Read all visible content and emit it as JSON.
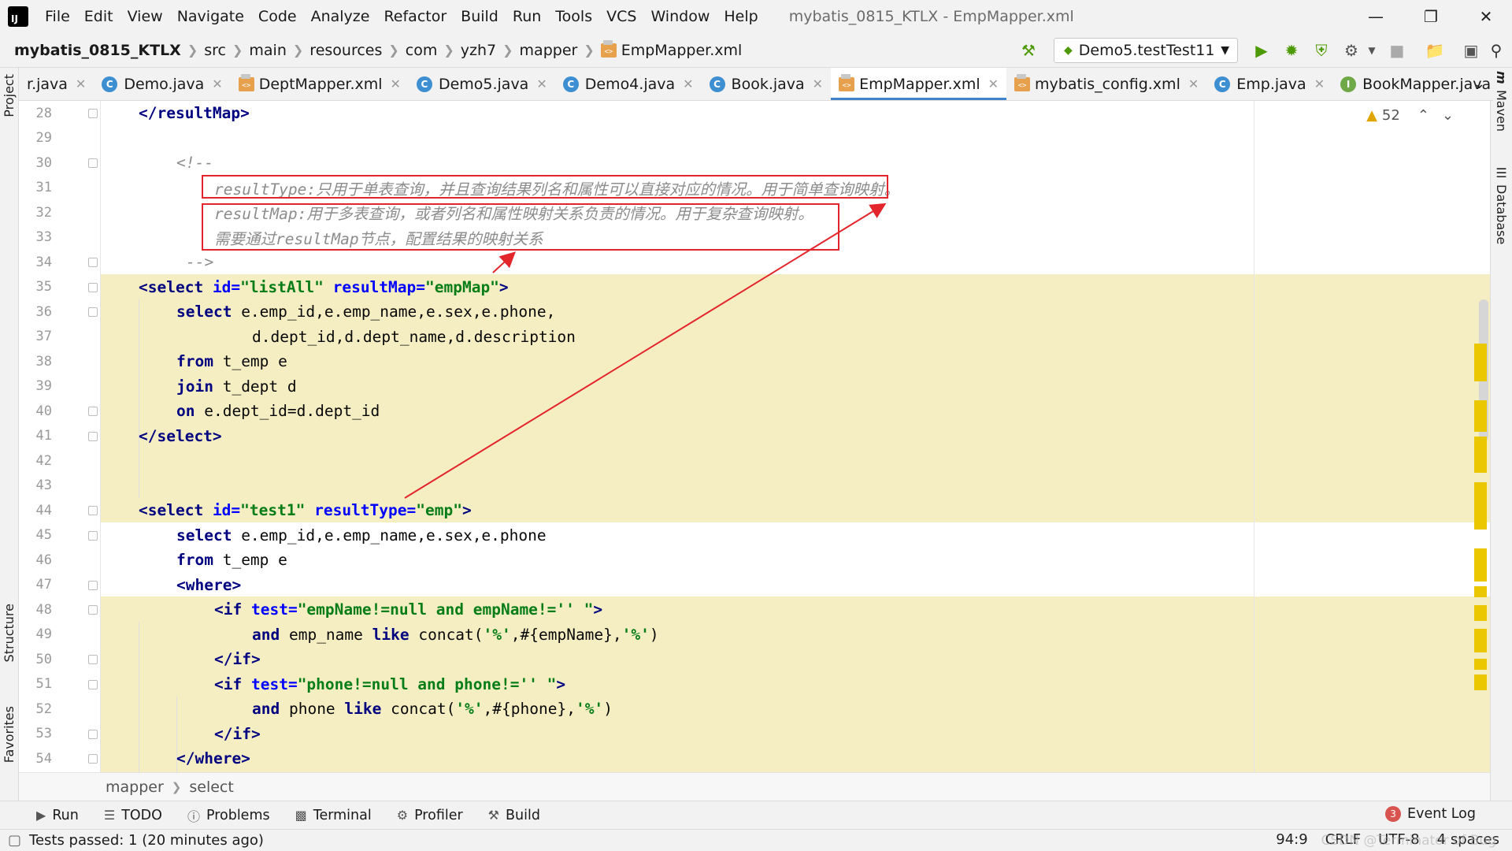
{
  "menubar": {
    "items": [
      "File",
      "Edit",
      "View",
      "Navigate",
      "Code",
      "Analyze",
      "Refactor",
      "Build",
      "Run",
      "Tools",
      "VCS",
      "Window",
      "Help"
    ],
    "window_title": "mybatis_0815_KTLX - EmpMapper.xml"
  },
  "navbar": {
    "project": "mybatis_0815_KTLX",
    "path": [
      "src",
      "main",
      "resources",
      "com",
      "yzh7",
      "mapper"
    ],
    "file": "EmpMapper.xml",
    "run_config": "Demo5.testTest11"
  },
  "tabs": [
    {
      "label": "r.java",
      "icon": "none"
    },
    {
      "label": "Demo.java",
      "icon": "class-icon"
    },
    {
      "label": "DeptMapper.xml",
      "icon": "xml-icon"
    },
    {
      "label": "Demo5.java",
      "icon": "class-icon"
    },
    {
      "label": "Demo4.java",
      "icon": "class-icon"
    },
    {
      "label": "Book.java",
      "icon": "class-icon"
    },
    {
      "label": "EmpMapper.xml",
      "icon": "xml-icon",
      "active": true
    },
    {
      "label": "mybatis_config.xml",
      "icon": "xml-icon"
    },
    {
      "label": "Emp.java",
      "icon": "class-icon"
    },
    {
      "label": "BookMapper.java",
      "icon": "interface-icon"
    }
  ],
  "side_panels": {
    "left_top": "Project",
    "left_structure": "Structure",
    "left_favorites": "Favorites",
    "right_maven": "Maven",
    "right_database": "Database"
  },
  "inspection": {
    "warnings": "52"
  },
  "code_lines": [
    {
      "n": "28",
      "text": "</resultMap>"
    },
    {
      "n": "29",
      "text": ""
    },
    {
      "n": "30",
      "text": "<!--"
    },
    {
      "n": "31",
      "text": "resultType:只用于单表查询，并且查询结果列名和属性可以直接对应的情况。用于简单查询映射。"
    },
    {
      "n": "32",
      "text": "resultMap:用于多表查询，或者列名和属性映射关系负责的情况。用于复杂查询映射。"
    },
    {
      "n": "33",
      "text": "需要通过resultMap节点，配置结果的映射关系"
    },
    {
      "n": "34",
      "text": "-->"
    },
    {
      "n": "35",
      "text": "<select id=\"listAll\" resultMap=\"empMap\">"
    },
    {
      "n": "36",
      "text": "select e.emp_id,e.emp_name,e.sex,e.phone,"
    },
    {
      "n": "37",
      "text": "d.dept_id,d.dept_name,d.description"
    },
    {
      "n": "38",
      "text": "from t_emp e"
    },
    {
      "n": "39",
      "text": "join t_dept d"
    },
    {
      "n": "40",
      "text": "on e.dept_id=d.dept_id"
    },
    {
      "n": "41",
      "text": "</select>"
    },
    {
      "n": "42",
      "text": ""
    },
    {
      "n": "43",
      "text": ""
    },
    {
      "n": "44",
      "text": "<select id=\"test1\" resultType=\"emp\">"
    },
    {
      "n": "45",
      "text": "select e.emp_id,e.emp_name,e.sex,e.phone"
    },
    {
      "n": "46",
      "text": "from t_emp e"
    },
    {
      "n": "47",
      "text": "<where>"
    },
    {
      "n": "48",
      "text": "<if test=\"empName!=null and empName!='' \">"
    },
    {
      "n": "49",
      "text": "and emp_name like concat('%',#{empName},'%')"
    },
    {
      "n": "50",
      "text": "</if>"
    },
    {
      "n": "51",
      "text": "<if test=\"phone!=null and phone!='' \">"
    },
    {
      "n": "52",
      "text": "and phone like concat('%',#{phone},'%')"
    },
    {
      "n": "53",
      "text": "</if>"
    },
    {
      "n": "54",
      "text": "</where>"
    }
  ],
  "breadcrumb": [
    "mapper",
    "select"
  ],
  "toolwindows": [
    "Run",
    "TODO",
    "Problems",
    "Terminal",
    "Profiler",
    "Build"
  ],
  "event_log": {
    "label": "Event Log",
    "count": "3"
  },
  "status": {
    "message": "Tests passed: 1 (20 minutes ago)",
    "position": "94:9",
    "line_sep": "CRLF",
    "encoding": "UTF-8",
    "indent": "4 spaces",
    "watermark": "CSDN @Terminator of Bug"
  },
  "colors": {
    "highlight": "#f5eec2",
    "annotation": "#e3262b",
    "active_tab_underline": "#4083c9"
  }
}
